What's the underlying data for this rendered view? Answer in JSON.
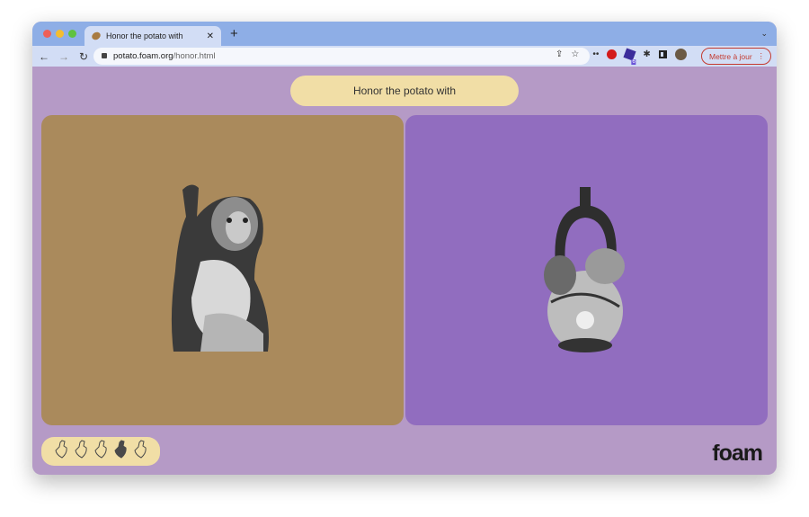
{
  "browser": {
    "tab_title": "Honor the potato with",
    "url_host": "potato.foam.org",
    "url_path": "/honor.html",
    "update_button": "Mettre à jour",
    "extension_badge": "6"
  },
  "page": {
    "prompt": "Honor the potato with",
    "logo": "foam",
    "left_panel": {
      "color": "#aa8a5c",
      "image": "monkey-sculpture"
    },
    "right_panel": {
      "color": "#916dbf",
      "image": "stirrup-spout-vessel"
    },
    "rating": {
      "icon": "trowel-icon",
      "count": 5,
      "selected": 4
    }
  }
}
